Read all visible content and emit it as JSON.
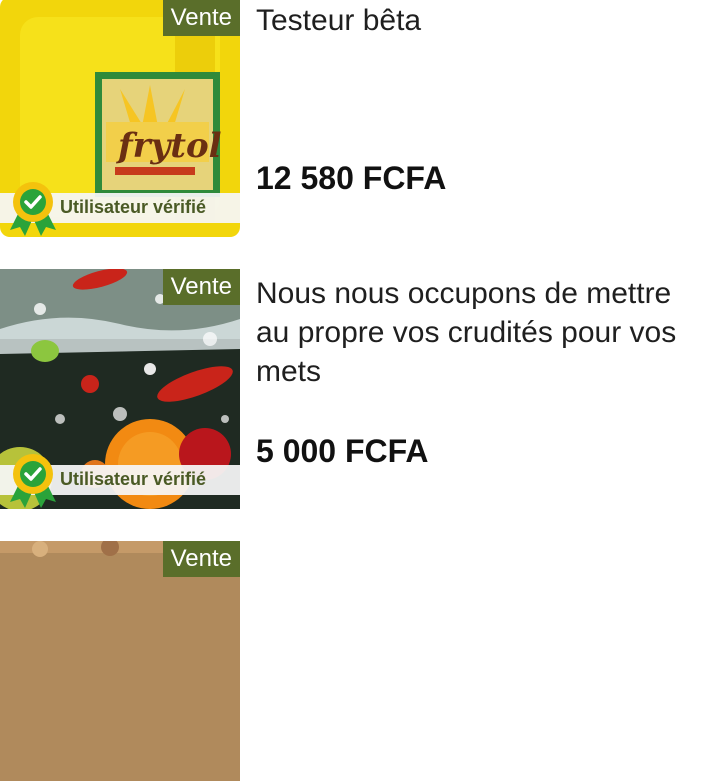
{
  "listings": [
    {
      "badge": "Vente",
      "verified": "Utilisateur vérifié",
      "title": "Testeur bêta",
      "price": "12 580 FCFA",
      "image_label": "frytol"
    },
    {
      "badge": "Vente",
      "verified": "Utilisateur vérifié",
      "title": "Nous nous occupons de mettre au propre vos crudités pour vos mets",
      "price": "5 000 FCFA"
    },
    {
      "badge": "Vente"
    }
  ],
  "colors": {
    "badge_bg": "#5a6e2a",
    "verified_text": "#4a5a25",
    "rosette_gold": "#f4c20d",
    "rosette_green": "#2aa33a"
  },
  "icons": {
    "verified": "verified-rosette-icon"
  }
}
